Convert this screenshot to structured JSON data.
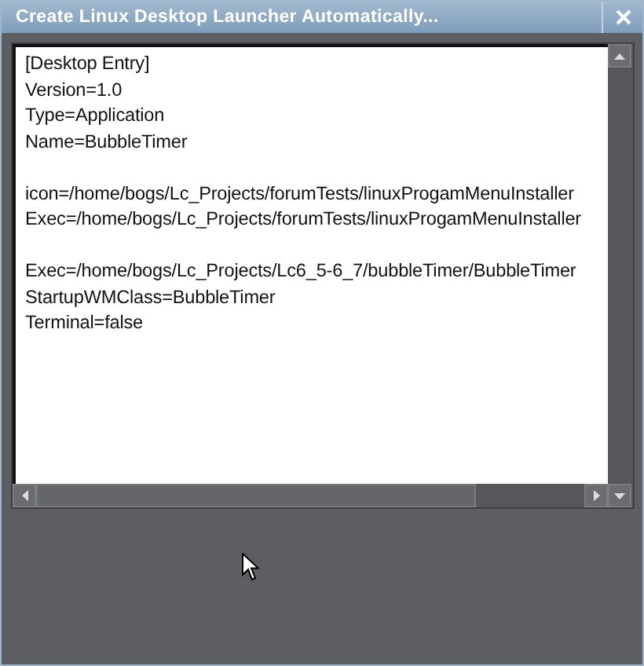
{
  "window": {
    "title": "Create Linux Desktop Launcher Automatically..."
  },
  "editor": {
    "blocks": [
      [
        "[Desktop Entry]",
        "Version=1.0",
        "Type=Application",
        "Name=BubbleTimer"
      ],
      [
        "icon=/home/bogs/Lc_Projects/forumTests/linuxProgamMenuInstaller",
        "Exec=/home/bogs/Lc_Projects/forumTests/linuxProgamMenuInstaller"
      ],
      [
        "Exec=/home/bogs/Lc_Projects/Lc6_5-6_7/bubbleTimer/BubbleTimer",
        "StartupWMClass=BubbleTimer",
        "Terminal=false"
      ]
    ]
  }
}
